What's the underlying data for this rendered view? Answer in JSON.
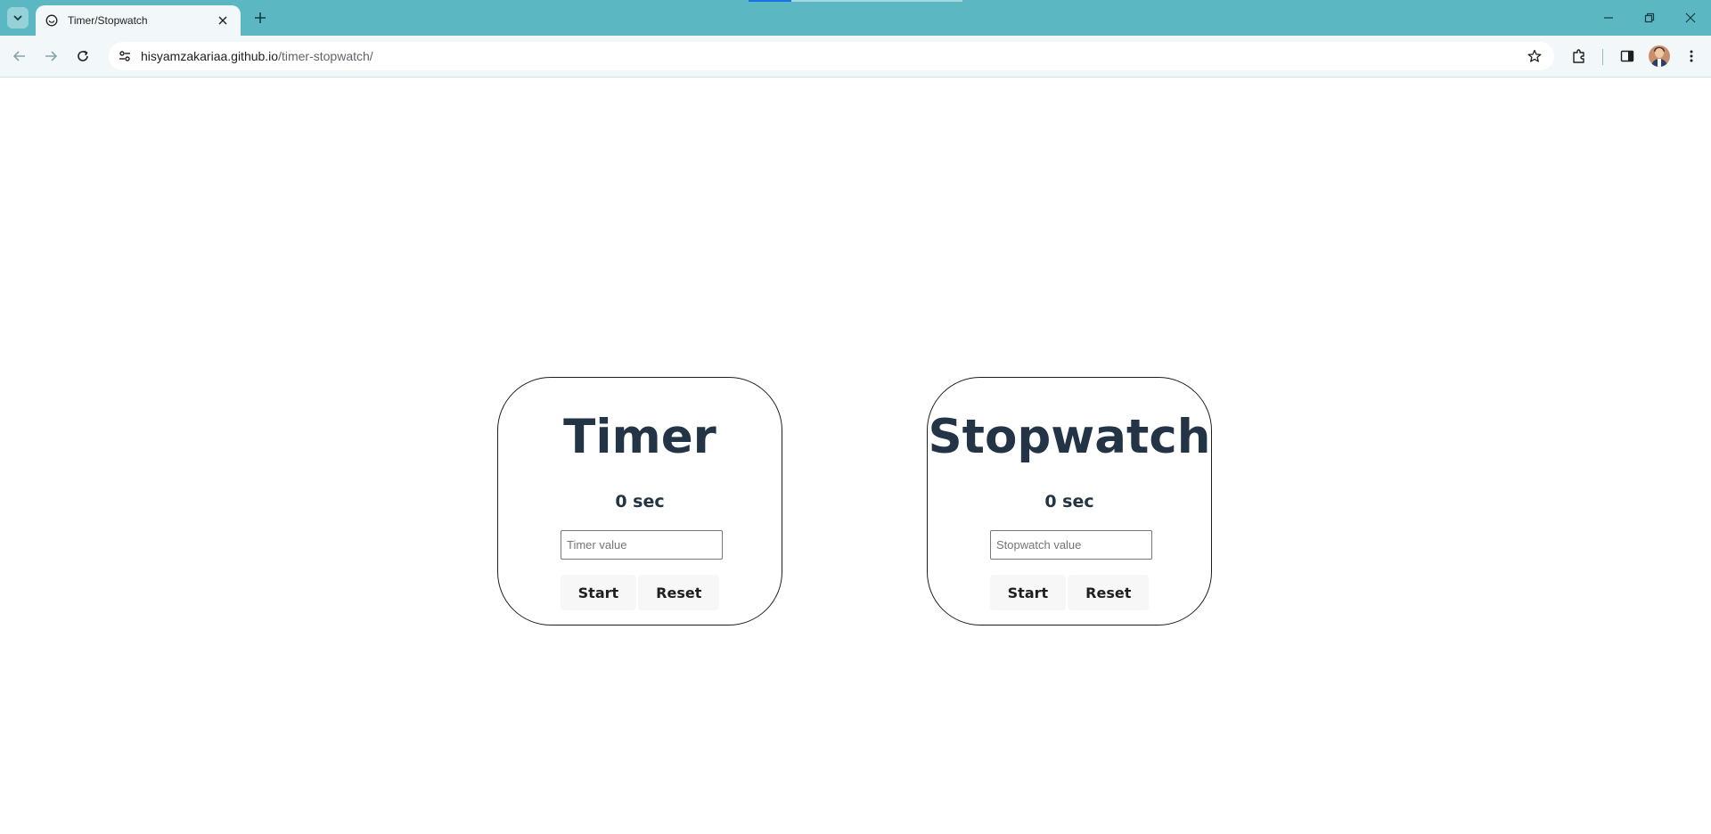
{
  "browser": {
    "tab_title": "Timer/Stopwatch",
    "url_domain": "hisyamzakariaa.github.io",
    "url_path": "/timer-stopwatch/",
    "theme_color": "#5bb8c3"
  },
  "timer": {
    "title": "Timer",
    "value": "0 sec",
    "input_placeholder": "Timer value",
    "start_label": "Start",
    "reset_label": "Reset"
  },
  "stopwatch": {
    "title": "Stopwatch",
    "value": "0 sec",
    "input_placeholder": "Stopwatch value",
    "start_label": "Start",
    "reset_label": "Reset"
  },
  "colors": {
    "heading": "#243447",
    "card_border": "#1f1f1f"
  }
}
